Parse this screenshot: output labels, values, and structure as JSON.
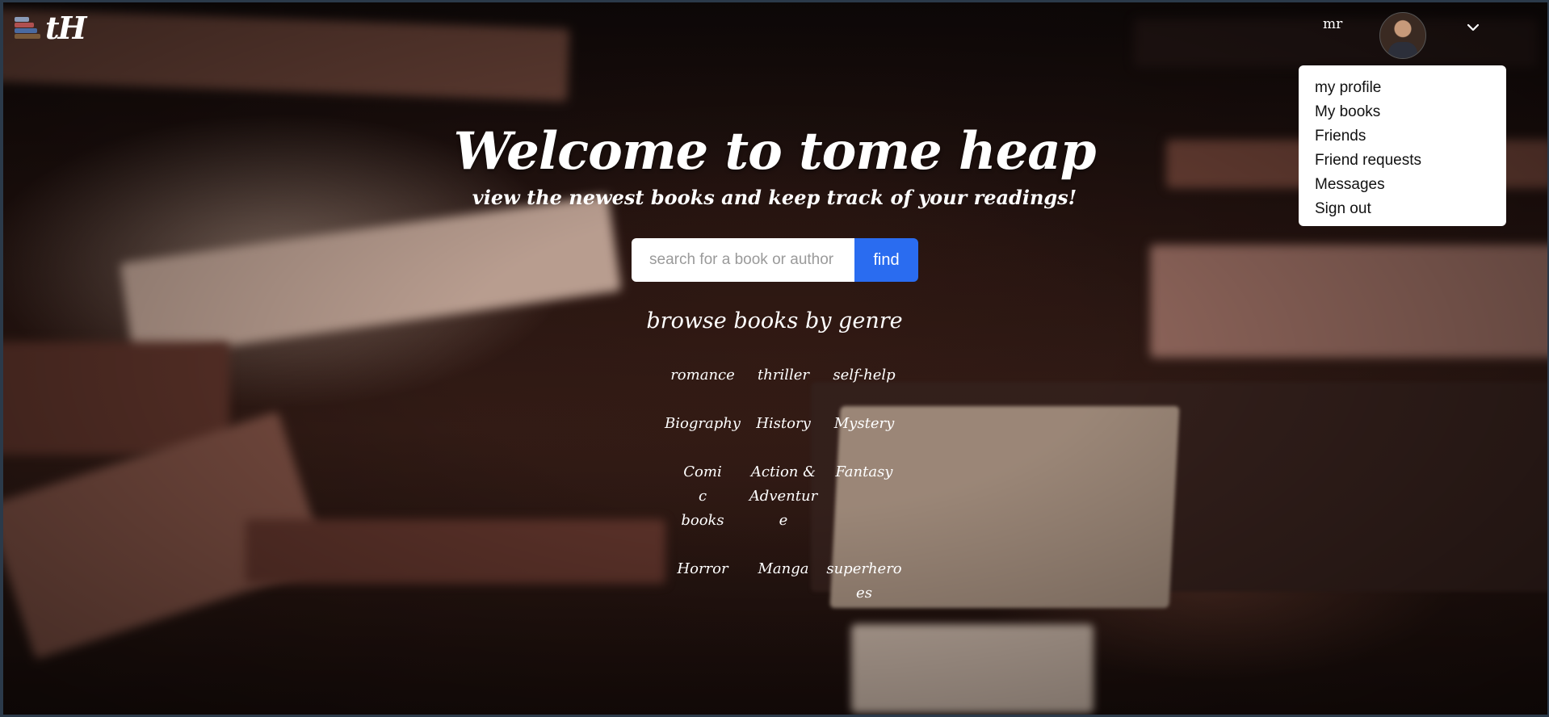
{
  "brand": {
    "logo_text": "tH"
  },
  "user": {
    "name": "mr"
  },
  "menu": {
    "items": [
      "my profile",
      "My books",
      "Friends",
      "Friend requests",
      "Messages",
      "Sign out"
    ]
  },
  "hero": {
    "title": "Welcome to tome heap",
    "subtitle": "view the newest books and keep track of your readings!"
  },
  "search": {
    "placeholder": "search for a book or author",
    "value": "",
    "button_label": "find"
  },
  "genres": {
    "heading": "browse books by genre",
    "items": [
      "romance",
      "thriller",
      "self-help",
      "Biography",
      "History",
      "Mystery",
      "Comic books",
      "Action & Adventure",
      "Fantasy",
      "Horror",
      "Manga",
      "superheroes"
    ]
  },
  "colors": {
    "accent": "#2a6cf0",
    "dropdown_bg": "#ffffff",
    "text_on_dark": "#ffffff"
  },
  "icons": {
    "chevron": "chevron-down-icon",
    "logo": "book-stack-icon"
  }
}
